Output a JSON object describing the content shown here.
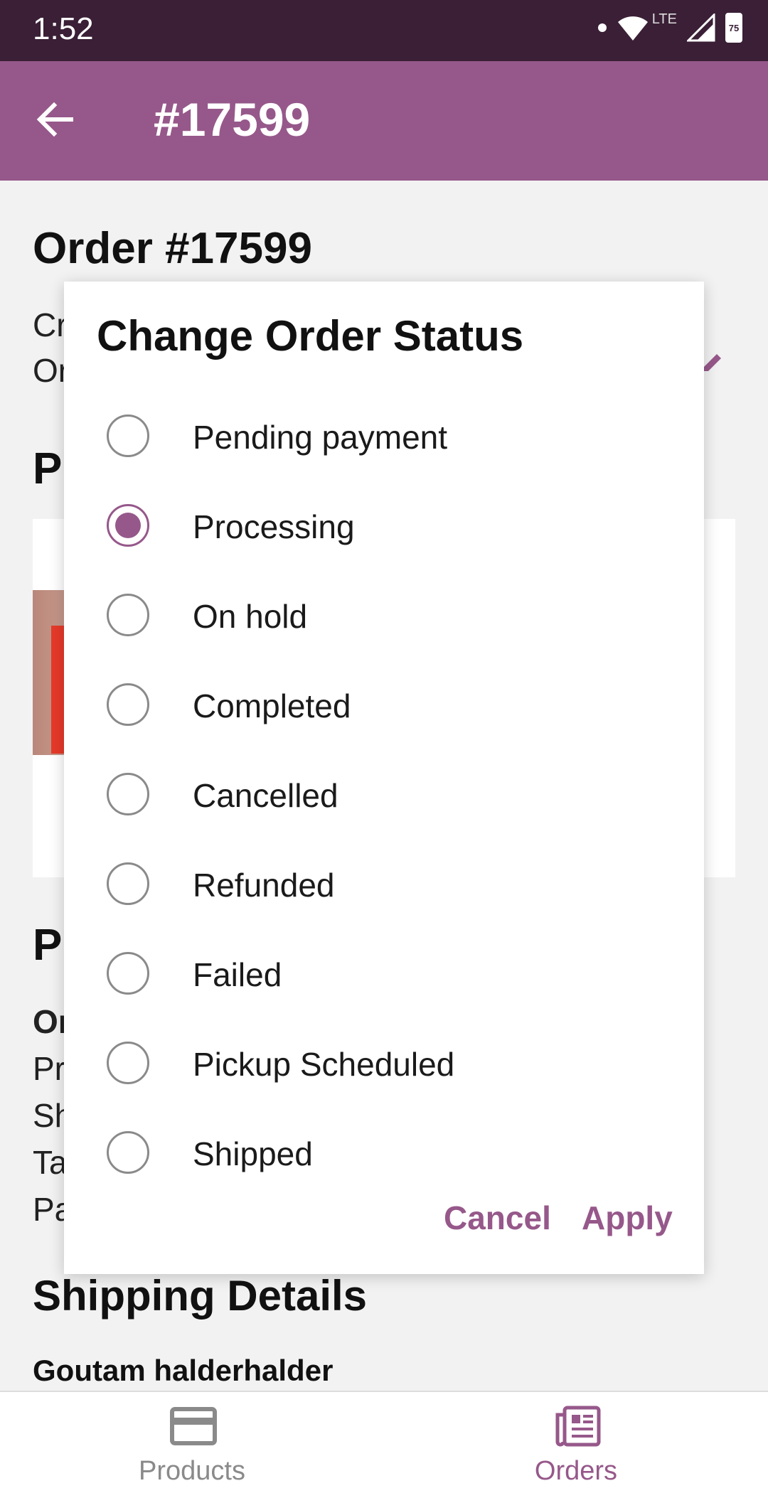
{
  "status_bar": {
    "time": "1:52",
    "network": "LTE",
    "battery": "75"
  },
  "app_bar": {
    "title": "#17599"
  },
  "background": {
    "order_title": "Order #17599",
    "meta_line_1": "Cr",
    "meta_line_2": "Or",
    "section_products": "P",
    "section_payment": "P",
    "payment_lines": [
      "Or",
      "Pr",
      "Sh",
      "Ta",
      "Pa"
    ],
    "shipping_title": "Shipping Details",
    "shipping_name": "Goutam halderhalder"
  },
  "dialog": {
    "title": "Change Order Status",
    "options": [
      {
        "label": "Pending payment",
        "checked": false
      },
      {
        "label": "Processing",
        "checked": true
      },
      {
        "label": "On hold",
        "checked": false
      },
      {
        "label": "Completed",
        "checked": false
      },
      {
        "label": "Cancelled",
        "checked": false
      },
      {
        "label": "Refunded",
        "checked": false
      },
      {
        "label": "Failed",
        "checked": false
      },
      {
        "label": "Pickup Scheduled",
        "checked": false
      },
      {
        "label": "Shipped",
        "checked": false
      }
    ],
    "cancel_label": "Cancel",
    "apply_label": "Apply"
  },
  "bottom_nav": {
    "items": [
      {
        "label": "Products",
        "active": false
      },
      {
        "label": "Orders",
        "active": true
      }
    ]
  },
  "colors": {
    "accent": "#96588a",
    "status_bar": "#3a1f36",
    "inactive": "#8a8a8a"
  }
}
